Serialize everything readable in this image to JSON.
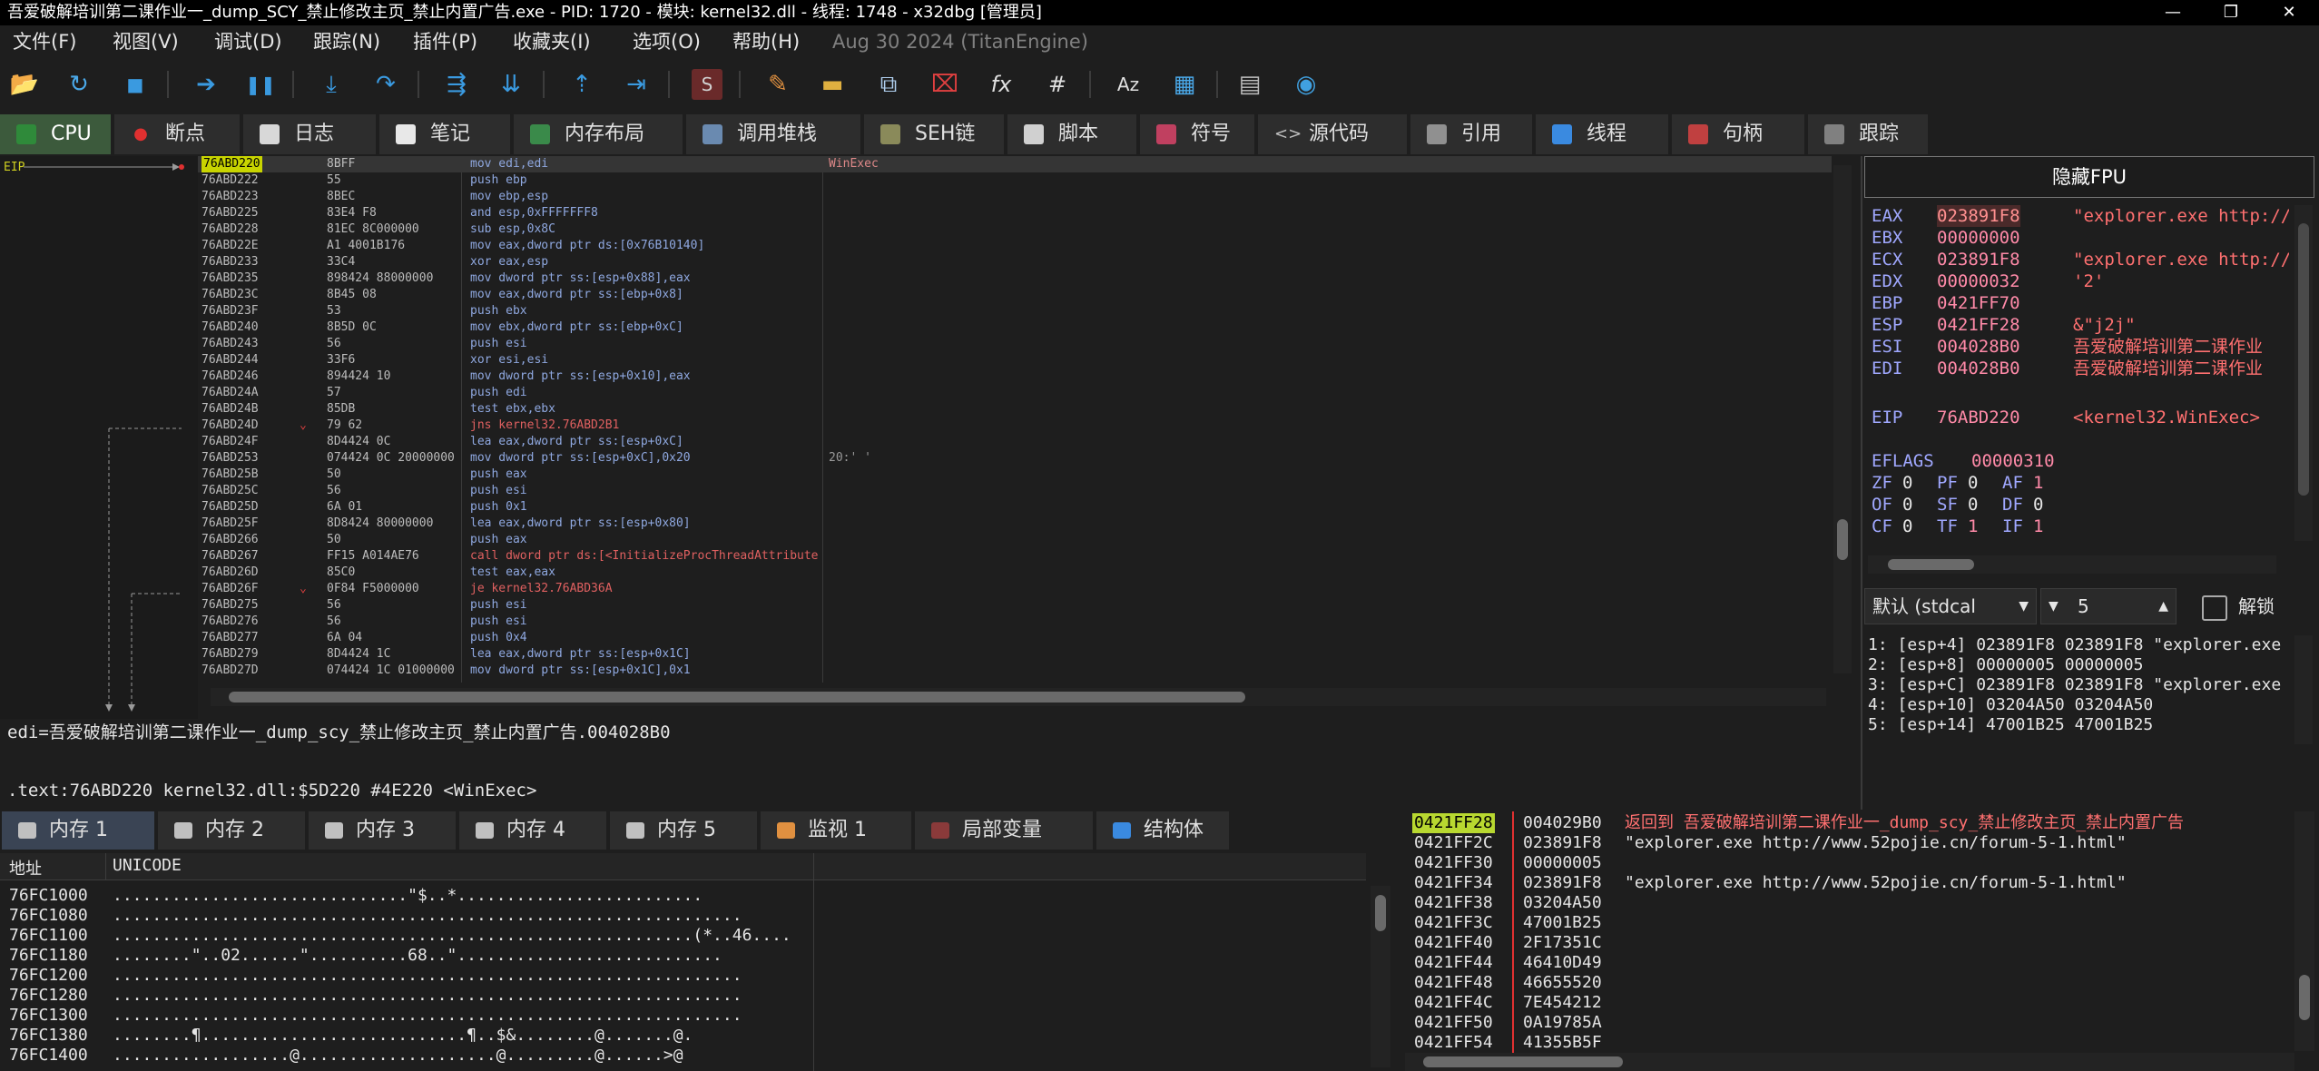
{
  "window": {
    "title": "吾爱破解培训第二课作业一_dump_SCY_禁止修改主页_禁止内置广告.exe - PID: 1720 - 模块: kernel32.dll - 线程: 1748 - x32dbg [管理员]",
    "min": "—",
    "max": "❐",
    "close": "✕"
  },
  "menu": {
    "items": [
      "文件(F)",
      "视图(V)",
      "调试(D)",
      "跟踪(N)",
      "插件(P)",
      "收藏夹(I)",
      "选项(O)",
      "帮助(H)"
    ],
    "date": "Aug 30 2024 (TitanEngine)"
  },
  "toolbar": {
    "icons": [
      "open-icon",
      "restart-icon",
      "stop-icon",
      "run-icon",
      "pause-icon",
      "step-into-icon",
      "step-over-icon",
      "trace-into-icon",
      "trace-over-icon",
      "execute-till-return-icon",
      "run-to-user-code-icon",
      "scylla-icon",
      "patch-icon",
      "comment-icon",
      "label-icon",
      "bookmark-icon",
      "function-icon",
      "hash-icon",
      "strings-icon",
      "calculator-icon",
      "cpuid-icon",
      "globe-icon"
    ],
    "glyphs": [
      "📂",
      "↻",
      "■",
      "➔",
      "❚❚",
      "⤓",
      "↷",
      "⇶",
      "⇊",
      "⇡",
      "⇥",
      "S",
      "✎",
      "▬",
      "⧉",
      "⌧",
      "fx",
      "#",
      "Az",
      "▤",
      "▦",
      "◉"
    ]
  },
  "tabs": [
    {
      "label": "CPU",
      "icon": "cpu-icon"
    },
    {
      "label": "断点",
      "icon": "breakpoint-icon"
    },
    {
      "label": "日志",
      "icon": "log-icon"
    },
    {
      "label": "笔记",
      "icon": "notes-icon"
    },
    {
      "label": "内存布局",
      "icon": "memory-map-icon"
    },
    {
      "label": "调用堆栈",
      "icon": "callstack-icon"
    },
    {
      "label": "SEH链",
      "icon": "seh-icon"
    },
    {
      "label": "脚本",
      "icon": "script-icon"
    },
    {
      "label": "符号",
      "icon": "symbols-icon"
    },
    {
      "label": "源代码",
      "icon": "source-icon"
    },
    {
      "label": "引用",
      "icon": "references-icon"
    },
    {
      "label": "线程",
      "icon": "threads-icon"
    },
    {
      "label": "句柄",
      "icon": "handles-icon"
    },
    {
      "label": "跟踪",
      "icon": "trace-icon"
    }
  ],
  "graph": {
    "eip_label": "EIP"
  },
  "disasm": {
    "rows": [
      {
        "addr": "76ABD220",
        "bytes": "8BFF",
        "instr": "mov edi,edi",
        "comment": "WinExec"
      },
      {
        "addr": "76ABD222",
        "bytes": "55",
        "instr": "push ebp",
        "comment": ""
      },
      {
        "addr": "76ABD223",
        "bytes": "8BEC",
        "instr": "mov ebp,esp",
        "comment": ""
      },
      {
        "addr": "76ABD225",
        "bytes": "83E4 F8",
        "instr": "and esp,0xFFFFFFF8",
        "comment": ""
      },
      {
        "addr": "76ABD228",
        "bytes": "81EC 8C000000",
        "instr": "sub esp,0x8C",
        "comment": ""
      },
      {
        "addr": "76ABD22E",
        "bytes": "A1 4001B176",
        "instr": "mov eax,dword ptr ds:[0x76B10140]",
        "comment": ""
      },
      {
        "addr": "76ABD233",
        "bytes": "33C4",
        "instr": "xor eax,esp",
        "comment": ""
      },
      {
        "addr": "76ABD235",
        "bytes": "898424 88000000",
        "instr": "mov dword ptr ss:[esp+0x88],eax",
        "comment": ""
      },
      {
        "addr": "76ABD23C",
        "bytes": "8B45 08",
        "instr": "mov eax,dword ptr ss:[ebp+0x8]",
        "comment": ""
      },
      {
        "addr": "76ABD23F",
        "bytes": "53",
        "instr": "push ebx",
        "comment": ""
      },
      {
        "addr": "76ABD240",
        "bytes": "8B5D 0C",
        "instr": "mov ebx,dword ptr ss:[ebp+0xC]",
        "comment": ""
      },
      {
        "addr": "76ABD243",
        "bytes": "56",
        "instr": "push esi",
        "comment": ""
      },
      {
        "addr": "76ABD244",
        "bytes": "33F6",
        "instr": "xor esi,esi",
        "comment": ""
      },
      {
        "addr": "76ABD246",
        "bytes": "894424 10",
        "instr": "mov dword ptr ss:[esp+0x10],eax",
        "comment": ""
      },
      {
        "addr": "76ABD24A",
        "bytes": "57",
        "instr": "push edi",
        "comment": ""
      },
      {
        "addr": "76ABD24B",
        "bytes": "85DB",
        "instr": "test ebx,ebx",
        "comment": ""
      },
      {
        "addr": "76ABD24D",
        "bytes": "79 62",
        "instr": "jns kernel32.76ABD2B1",
        "comment": ""
      },
      {
        "addr": "76ABD24F",
        "bytes": "8D4424 0C",
        "instr": "lea eax,dword ptr ss:[esp+0xC]",
        "comment": ""
      },
      {
        "addr": "76ABD253",
        "bytes": "074424 0C 20000000",
        "instr": "mov dword ptr ss:[esp+0xC],0x20",
        "comment": "20:' '"
      },
      {
        "addr": "76ABD25B",
        "bytes": "50",
        "instr": "push eax",
        "comment": ""
      },
      {
        "addr": "76ABD25C",
        "bytes": "56",
        "instr": "push esi",
        "comment": ""
      },
      {
        "addr": "76ABD25D",
        "bytes": "6A 01",
        "instr": "push 0x1",
        "comment": ""
      },
      {
        "addr": "76ABD25F",
        "bytes": "8D8424 80000000",
        "instr": "lea eax,dword ptr ss:[esp+0x80]",
        "comment": ""
      },
      {
        "addr": "76ABD266",
        "bytes": "50",
        "instr": "push eax",
        "comment": ""
      },
      {
        "addr": "76ABD267",
        "bytes": "FF15 A014AE76",
        "instr": "call dword ptr ds:[<InitializeProcThreadAttribute",
        "comment": ""
      },
      {
        "addr": "76ABD26D",
        "bytes": "85C0",
        "instr": "test eax,eax",
        "comment": ""
      },
      {
        "addr": "76ABD26F",
        "bytes": "0F84 F5000000",
        "instr": "je kernel32.76ABD36A",
        "comment": ""
      },
      {
        "addr": "76ABD275",
        "bytes": "56",
        "instr": "push esi",
        "comment": ""
      },
      {
        "addr": "76ABD276",
        "bytes": "56",
        "instr": "push esi",
        "comment": ""
      },
      {
        "addr": "76ABD277",
        "bytes": "6A 04",
        "instr": "push 0x4",
        "comment": ""
      },
      {
        "addr": "76ABD279",
        "bytes": "8D4424 1C",
        "instr": "lea eax,dword ptr ss:[esp+0x1C]",
        "comment": ""
      },
      {
        "addr": "76ABD27D",
        "bytes": "074424 1C 01000000",
        "instr": "mov dword ptr ss:[esp+0x1C],0x1",
        "comment": ""
      }
    ]
  },
  "info": {
    "line1": "edi=吾爱破解培训第二课作业一_dump_scy_禁止修改主页_禁止内置广告.004028B0",
    "line2": ".text:76ABD220 kernel32.dll:$5D220 #4E220 <WinExec>"
  },
  "fpu": {
    "button": "隐藏FPU"
  },
  "registers": [
    {
      "name": "EAX",
      "value": "023891F8",
      "comment": "\"explorer.exe http://w"
    },
    {
      "name": "EBX",
      "value": "00000000",
      "comment": ""
    },
    {
      "name": "ECX",
      "value": "023891F8",
      "comment": "\"explorer.exe http://w"
    },
    {
      "name": "EDX",
      "value": "00000032",
      "comment": "'2'"
    },
    {
      "name": "EBP",
      "value": "0421FF70",
      "comment": ""
    },
    {
      "name": "ESP",
      "value": "0421FF28",
      "comment": "&\"j2j\""
    },
    {
      "name": "ESI",
      "value": "004028B0",
      "comment": "吾爱破解培训第二课作业"
    },
    {
      "name": "EDI",
      "value": "004028B0",
      "comment": "吾爱破解培训第二课作业"
    }
  ],
  "eip": {
    "name": "EIP",
    "value": "76ABD220",
    "comment": "<kernel32.WinExec>"
  },
  "eflags": {
    "name": "EFLAGS",
    "value": "00000310"
  },
  "flags": [
    [
      {
        "n": "ZF",
        "v": "0"
      },
      {
        "n": "PF",
        "v": "0"
      },
      {
        "n": "AF",
        "v": "1"
      }
    ],
    [
      {
        "n": "OF",
        "v": "0"
      },
      {
        "n": "SF",
        "v": "0"
      },
      {
        "n": "DF",
        "v": "0"
      }
    ],
    [
      {
        "n": "CF",
        "v": "0"
      },
      {
        "n": "TF",
        "v": "1"
      },
      {
        "n": "IF",
        "v": "1"
      }
    ]
  ],
  "callconv": {
    "select": "默认 (stdcal",
    "count": "5",
    "unlock": "解锁"
  },
  "stackargs": [
    "1: [esp+4] 023891F8 023891F8 \"explorer.exe",
    "2: [esp+8] 00000005 00000005",
    "3: [esp+C] 023891F8 023891F8 \"explorer.exe",
    "4: [esp+10] 03204A50 03204A50",
    "5: [esp+14] 47001B25 47001B25"
  ],
  "btabs": [
    {
      "label": "内存 1",
      "icon": "dump-icon"
    },
    {
      "label": "内存 2",
      "icon": "dump-icon"
    },
    {
      "label": "内存 3",
      "icon": "dump-icon"
    },
    {
      "label": "内存 4",
      "icon": "dump-icon"
    },
    {
      "label": "内存 5",
      "icon": "dump-icon"
    },
    {
      "label": "监视 1",
      "icon": "watch-icon"
    },
    {
      "label": "局部变量",
      "icon": "locals-icon"
    },
    {
      "label": "结构体",
      "icon": "struct-icon"
    }
  ],
  "dump": {
    "headers": {
      "addr": "地址",
      "unicode": "UNICODE"
    },
    "rows": [
      {
        "addr": "76FC1000",
        "text": "..............................\"$..*........................."
      },
      {
        "addr": "76FC1080",
        "text": "................................................................"
      },
      {
        "addr": "76FC1100",
        "text": "...........................................................(*..46...."
      },
      {
        "addr": "76FC1180",
        "text": "........\"..02......\"..........68..\"..........................."
      },
      {
        "addr": "76FC1200",
        "text": "................................................................"
      },
      {
        "addr": "76FC1280",
        "text": "................................................................"
      },
      {
        "addr": "76FC1300",
        "text": "................................................................"
      },
      {
        "addr": "76FC1380",
        "text": "........¶...........................¶..$&........@.......@."
      },
      {
        "addr": "76FC1400",
        "text": "..................@....................@.........@......>@"
      }
    ]
  },
  "stack": {
    "rows": [
      {
        "addr": "0421FF28",
        "value": "004029B0",
        "comment": "返回到 吾爱破解培训第二课作业一_dump_scy_禁止修改主页_禁止内置广告"
      },
      {
        "addr": "0421FF2C",
        "value": "023891F8",
        "comment": "\"explorer.exe http://www.52pojie.cn/forum-5-1.html\""
      },
      {
        "addr": "0421FF30",
        "value": "00000005",
        "comment": ""
      },
      {
        "addr": "0421FF34",
        "value": "023891F8",
        "comment": "\"explorer.exe http://www.52pojie.cn/forum-5-1.html\""
      },
      {
        "addr": "0421FF38",
        "value": "03204A50",
        "comment": ""
      },
      {
        "addr": "0421FF3C",
        "value": "47001B25",
        "comment": ""
      },
      {
        "addr": "0421FF40",
        "value": "2F17351C",
        "comment": ""
      },
      {
        "addr": "0421FF44",
        "value": "46410D49",
        "comment": ""
      },
      {
        "addr": "0421FF48",
        "value": "46655520",
        "comment": ""
      },
      {
        "addr": "0421FF4C",
        "value": "7E454212",
        "comment": ""
      },
      {
        "addr": "0421FF50",
        "value": "0A19785A",
        "comment": ""
      },
      {
        "addr": "0421FF54",
        "value": "41355B5F",
        "comment": ""
      }
    ]
  }
}
